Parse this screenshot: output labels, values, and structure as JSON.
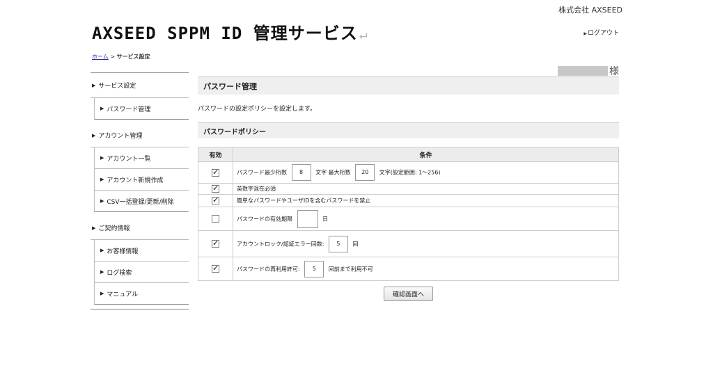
{
  "header": {
    "company": "株式会社 AXSEED",
    "title": "AXSEED SPPM ID 管理サービス",
    "return_mark": "↵",
    "logout": "ログアウト"
  },
  "breadcrumb": {
    "home": "ホーム",
    "sep": ">",
    "current": "サービス設定"
  },
  "user": {
    "suffix": "様"
  },
  "sidebar": {
    "sections": [
      {
        "label": "サービス設定",
        "items": [
          "パスワード管理"
        ]
      },
      {
        "label": "アカウント管理",
        "items": [
          "アカウント一覧",
          "アカウント新規作成",
          "CSV一括登録/更新/削除"
        ]
      },
      {
        "label": "ご契約情報",
        "items": [
          "お客様情報",
          "ログ検索",
          "マニュアル"
        ]
      }
    ]
  },
  "main": {
    "title": "パスワード管理",
    "description": "パスワードの設定ポリシーを設定します。",
    "policy_title": "パスワードポリシー",
    "table": {
      "col_enabled": "有効",
      "col_condition": "条件",
      "rows": [
        {
          "checked": true,
          "pre": "パスワード最少桁数",
          "v1": "8",
          "mid": "文字 最大桁数",
          "v2": "20",
          "post": "文字(設定範囲: 1〜256)"
        },
        {
          "checked": true,
          "text": "英数字混在必須"
        },
        {
          "checked": true,
          "text": "簡単なパスワードやユーザIDを含むパスワードを禁止"
        },
        {
          "checked": false,
          "pre": "パスワードの有効期限",
          "value": "",
          "post": "日"
        },
        {
          "checked": true,
          "pre": "アカウントロック/認証エラー回数:",
          "value": "5",
          "post": "回"
        },
        {
          "checked": true,
          "pre": "パスワードの再利用許可:",
          "value": "5",
          "post": "回前まで利用不可"
        }
      ]
    },
    "confirm_button": "確認画面へ"
  }
}
